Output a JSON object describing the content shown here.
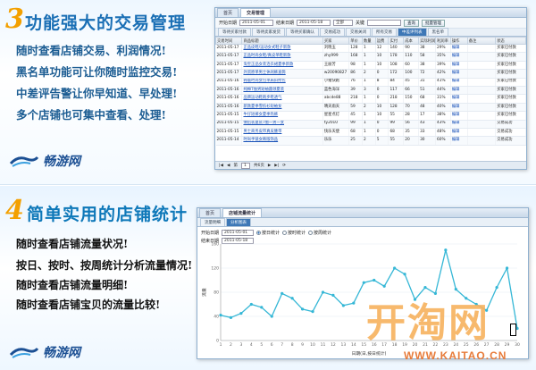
{
  "panel1": {
    "number": "3",
    "title": "功能强大的交易管理",
    "features": [
      "随时查看店铺交易、利润情况!",
      "黑名单功能可让你随时监控交易!",
      "中差评告警让你早知道、早处理!",
      "多个店铺也可集中查看、处理!"
    ],
    "logo_text": "畅游网"
  },
  "panel2": {
    "number": "4",
    "title": "简单实用的店铺统计",
    "features": [
      "随时查看店铺流量状况!",
      "按日、按时、按周统计分析流量情况!",
      "随时查看店铺流量明细!",
      "随时查看店铺宝贝的流量比较!"
    ],
    "logo_text": "畅游网"
  },
  "win1": {
    "tabs": [
      "首页",
      "交易管理"
    ],
    "toolbar": {
      "start_label": "开始日期",
      "start_value": "2011-05-01",
      "end_label": "结束日期",
      "end_value": "2011-05-18",
      "status_value": "全部",
      "search_label": "关键",
      "search_button": "查询",
      "export_button": "批量管理"
    },
    "subtabs": [
      "等待买家付款",
      "等待卖家发货",
      "等待买家确认",
      "交易成功",
      "交易关闭",
      "所有交易",
      "中差评列表",
      "黑名单"
    ],
    "columns": [
      "交易时间",
      "商品标题",
      "买家",
      "单价",
      "数量",
      "运费",
      "实付",
      "成本",
      "实际利润",
      "利润率",
      "操作",
      "备注",
      "状态"
    ],
    "rows": [
      [
        "2011-05-17",
        "正品皮鞋/运动女式鞋子新款",
        "刘晓玉",
        "128",
        "1",
        "12",
        "140",
        "90",
        "38",
        "29%",
        "编辑",
        "",
        "买家已付款"
      ],
      [
        "2011-05-17",
        "正品时尚女鞋/真皮单鞋新款",
        "zhy999",
        "168",
        "1",
        "10",
        "178",
        "110",
        "58",
        "35%",
        "编辑",
        "",
        "买家已付款"
      ],
      [
        "2011-05-17",
        "淘宝正品女装连衣裙夏季新款",
        "王丽芳",
        "98",
        "1",
        "10",
        "108",
        "60",
        "38",
        "39%",
        "编辑",
        "",
        "买家已付款"
      ],
      [
        "2011-05-17",
        "外贸原单男士休闲裤直筒",
        "w20090827",
        "86",
        "2",
        "0",
        "172",
        "100",
        "72",
        "42%",
        "编辑",
        "",
        "买家已付款"
      ],
      [
        "2011-05-16",
        "韩版时尚女包单肩斜挎包",
        "小猪快跑",
        "76",
        "1",
        "8",
        "84",
        "45",
        "31",
        "41%",
        "编辑",
        "",
        "买家已付款"
      ],
      [
        "2011-05-16",
        "纯棉T恤男短袖圆领夏装",
        "蓝色海洋",
        "39",
        "3",
        "0",
        "117",
        "66",
        "51",
        "44%",
        "编辑",
        "",
        "买家已付款"
      ],
      [
        "2011-05-16",
        "品牌运动鞋跑步鞋透气",
        "abcde88",
        "218",
        "1",
        "0",
        "218",
        "150",
        "68",
        "31%",
        "编辑",
        "",
        "买家已付款"
      ],
      [
        "2011-05-16",
        "新款夏季雪纺衫短袖女",
        "晴天雨天",
        "59",
        "2",
        "10",
        "128",
        "70",
        "48",
        "40%",
        "编辑",
        "",
        "买家已付款"
      ],
      [
        "2011-05-15",
        "牛仔短裤女夏季热裤",
        "星星点灯",
        "45",
        "1",
        "10",
        "55",
        "28",
        "17",
        "38%",
        "编辑",
        "",
        "买家已付款"
      ],
      [
        "2011-05-15",
        "情侣装夏装T恤一男一女",
        "ty2010",
        "99",
        "1",
        "0",
        "99",
        "56",
        "43",
        "43%",
        "编辑",
        "",
        "交易成功"
      ],
      [
        "2011-05-15",
        "男士商务皮带真皮腰带",
        "快乐天使",
        "68",
        "1",
        "0",
        "68",
        "35",
        "33",
        "48%",
        "编辑",
        "",
        "交易成功"
      ],
      [
        "2011-05-14",
        "时尚手链女韩版饰品",
        "乐乐",
        "25",
        "2",
        "5",
        "55",
        "20",
        "30",
        "60%",
        "编辑",
        "",
        "交易成功"
      ]
    ],
    "footer": {
      "page_label": "第",
      "page_value": "1",
      "total_label": "共6页"
    }
  },
  "win2": {
    "tabs": [
      "首页",
      "店铺流量统计"
    ],
    "toolbar": {
      "data_tab": "流量明细",
      "chart_tab": "分析图表"
    },
    "form": {
      "start_label": "开始日期",
      "start_value": "2011-05-01",
      "end_label": "结束日期",
      "end_value": "2011-05-18",
      "options": [
        "按日统计",
        "按时统计",
        "按周统计"
      ],
      "selected": "按日统计"
    },
    "chart_title": "店铺每日流量统计",
    "chart_xlabel": "日期(日,按日统计)",
    "chart_ylabel": "流量"
  },
  "chart_data": {
    "type": "line",
    "title": "店铺每日流量统计",
    "xlabel": "日期(日,按日统计)",
    "ylabel": "流量",
    "x": [
      1,
      2,
      3,
      4,
      5,
      6,
      7,
      8,
      9,
      10,
      11,
      12,
      13,
      14,
      15,
      16,
      17,
      18,
      19,
      20,
      21,
      22,
      23,
      24,
      25,
      26,
      27,
      28,
      29,
      30
    ],
    "series": [
      {
        "name": "流量",
        "values": [
          42,
          38,
          45,
          60,
          55,
          40,
          78,
          70,
          52,
          48,
          80,
          75,
          58,
          62,
          96,
          100,
          90,
          120,
          110,
          68,
          88,
          78,
          150,
          85,
          70,
          60,
          50,
          88,
          120,
          20
        ]
      }
    ],
    "ylim": [
      0,
      160
    ],
    "grid": true
  },
  "watermark": {
    "text": "开淘网",
    "url": "WWW.KAITAO.CN"
  },
  "colors": {
    "title_blue": "#1a6fb5",
    "number_orange": "#f3a000",
    "line": "#35b7d6",
    "watermark": "#f7b25e"
  }
}
